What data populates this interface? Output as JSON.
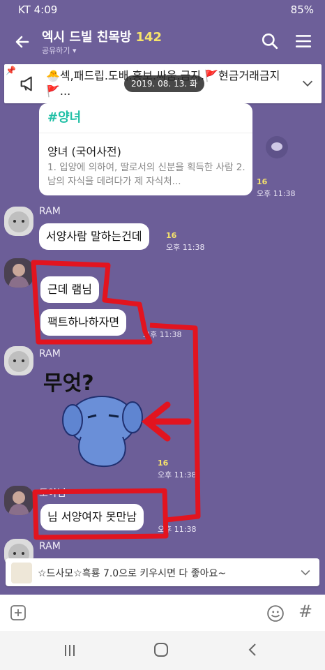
{
  "status": {
    "carrier_time": "KT 4:09",
    "battery": "85%"
  },
  "header": {
    "title": "엑시 드빌 친목방",
    "member_count": "142",
    "subtitle": "공유하기 ▾"
  },
  "notice": {
    "text": "🐣섹,패드립.도배.홍보.싸움.금지.🚩현금거래금지🚩...",
    "date_chip": "2019. 08. 13. 화"
  },
  "messages": {
    "card": {
      "tag": "#양녀",
      "title": "양녀 (국어사전)",
      "desc": "1. 입양에 의하여, 딸로서의 신분을 획득한 사람 2. 남의 자식을 데려다가 제 자식처...",
      "unread": "16",
      "time": "오후 11:38"
    },
    "ram1": {
      "name": "RAM",
      "text": "서양사람 말하는건데",
      "unread": "16",
      "time": "오후 11:38"
    },
    "tt1": {
      "b1": "근데 램님",
      "b2": "팩트하나하자면",
      "time": "오후 11:38"
    },
    "ram2": {
      "name": "RAM",
      "sticker_text": "무엇?",
      "unread": "16",
      "time": "오후 11:38"
    },
    "tt2": {
      "name": "토야님",
      "text": "님 서양여자 못만남",
      "time": "오후 11:38"
    },
    "ram3": {
      "name": "RAM"
    }
  },
  "promo": {
    "text": "☆드사모☆흑룡 7.0으로 키우시면 다 좋아요~"
  },
  "input": {
    "hash": "#"
  }
}
